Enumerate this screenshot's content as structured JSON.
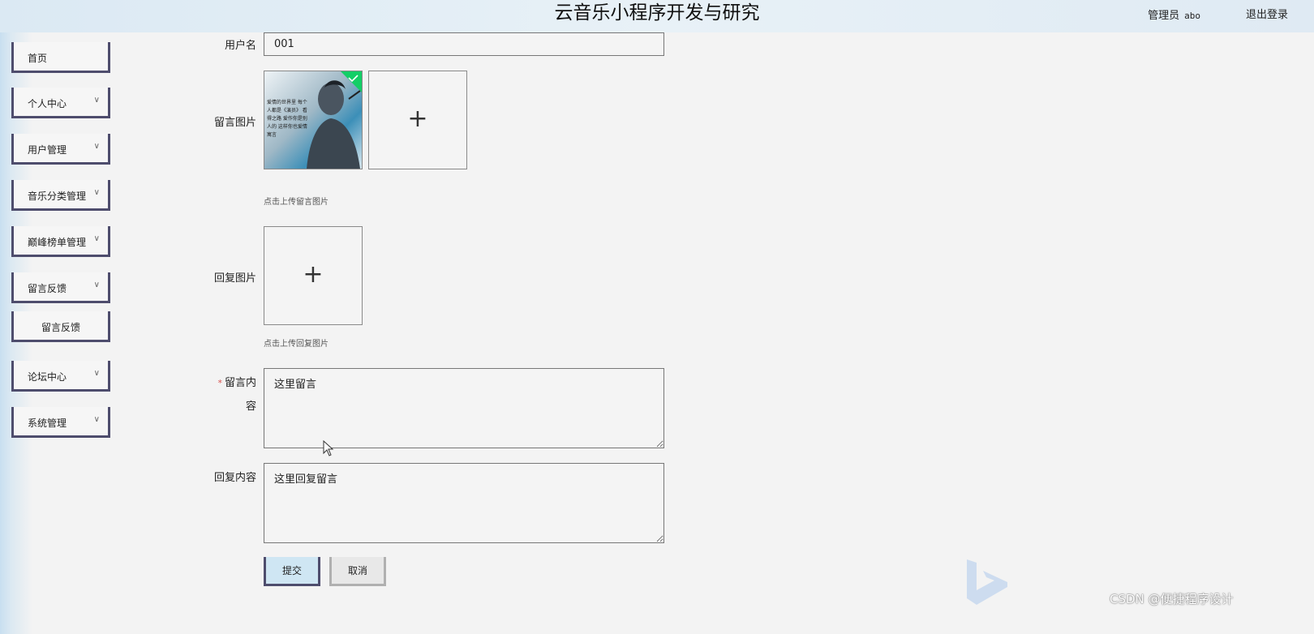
{
  "header": {
    "title": "云音乐小程序开发与研究",
    "role": "管理员",
    "username": "abo",
    "logout": "退出登录"
  },
  "sidebar": {
    "items": [
      {
        "label": "首页"
      },
      {
        "label": "个人中心"
      },
      {
        "label": "用户管理"
      },
      {
        "label": "音乐分类管理"
      },
      {
        "label": "巅峰榜单管理"
      },
      {
        "label": "留言反馈"
      },
      {
        "label": "留言反馈"
      },
      {
        "label": "论坛中心"
      },
      {
        "label": "系统管理"
      }
    ]
  },
  "form": {
    "username_label": "用户名",
    "username_value": "001",
    "message_image_label": "留言图片",
    "message_image_hint": "点击上传留言图片",
    "message_image_caption": "爱情的世界里 每个人都是《演员》 看得之路 爱作你是别人的 这样你也爱情寓言",
    "reply_image_label": "回复图片",
    "reply_image_hint": "点击上传回复图片",
    "required_mark": "*",
    "message_content_label_1": "留言内",
    "message_content_label_2": "容",
    "message_content_value": "这里留言",
    "reply_content_label": "回复内容",
    "reply_content_value": "这里回复留言",
    "submit": "提交",
    "cancel": "取消",
    "plus_glyph": "+"
  },
  "watermark": "CSDN @便捷程序设计",
  "colors": {
    "sidebar_border": "#4e4d6d",
    "submit_bg": "#cfe6f3",
    "required": "#d9534f",
    "upload_check": "#13ce66"
  }
}
